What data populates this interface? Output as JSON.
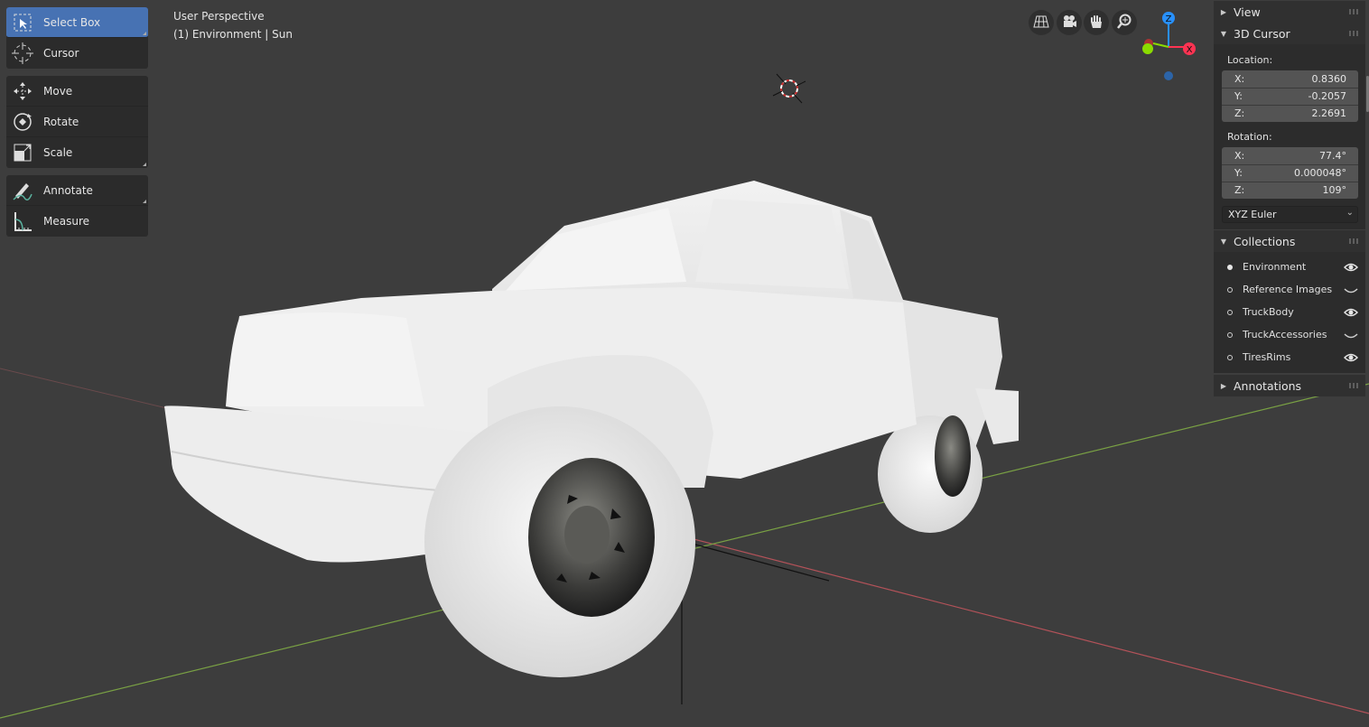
{
  "toolbar": {
    "groups": [
      [
        {
          "label": "Select Box",
          "icon": "select-box-icon",
          "active": true
        },
        {
          "label": "Cursor",
          "icon": "cursor-icon",
          "active": false
        }
      ],
      [
        {
          "label": "Move",
          "icon": "move-icon"
        },
        {
          "label": "Rotate",
          "icon": "rotate-icon"
        },
        {
          "label": "Scale",
          "icon": "scale-icon"
        }
      ],
      [
        {
          "label": "Annotate",
          "icon": "annotate-icon"
        },
        {
          "label": "Measure",
          "icon": "measure-icon"
        }
      ]
    ]
  },
  "viewport": {
    "perspective_label": "User Perspective",
    "context_label": "(1) Environment | Sun",
    "nav_buttons": [
      "grid-view-icon",
      "camera-icon",
      "hand-pan-icon",
      "zoom-icon"
    ],
    "gizmo": {
      "z": "Z",
      "x": "X"
    },
    "colors": {
      "background": "#3d3d3d",
      "x_axis": "#c9565b",
      "y_axis": "#7fa040",
      "model": "#ebebeb",
      "x_gizmo": "#ff3352",
      "y_gizmo": "#8bdc00",
      "z_gizmo": "#2890ff"
    }
  },
  "npanel": {
    "view_header": "View",
    "cursor_header": "3D Cursor",
    "location_label": "Location:",
    "location": [
      {
        "axis": "X:",
        "value": "0.8360"
      },
      {
        "axis": "Y:",
        "value": "-0.2057"
      },
      {
        "axis": "Z:",
        "value": "2.2691"
      }
    ],
    "rotation_label": "Rotation:",
    "rotation": [
      {
        "axis": "X:",
        "value": "77.4°"
      },
      {
        "axis": "Y:",
        "value": "0.000048°"
      },
      {
        "axis": "Z:",
        "value": "109°"
      }
    ],
    "rotation_mode": "XYZ Euler",
    "collections_header": "Collections",
    "collections": [
      {
        "name": "Environment",
        "active": true,
        "visible": true
      },
      {
        "name": "Reference Images",
        "active": false,
        "visible": false
      },
      {
        "name": "TruckBody",
        "active": false,
        "visible": true
      },
      {
        "name": "TruckAccessories",
        "active": false,
        "visible": false
      },
      {
        "name": "TiresRims",
        "active": false,
        "visible": true
      }
    ],
    "annotations_header": "Annotations"
  }
}
